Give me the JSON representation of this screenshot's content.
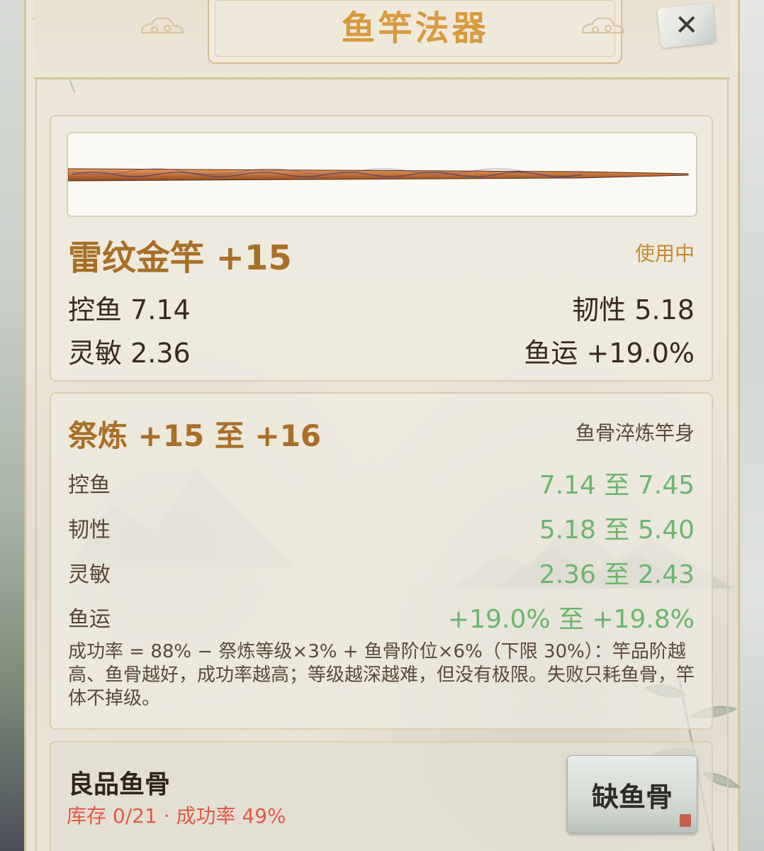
{
  "header": {
    "title": "鱼竿法器",
    "close_label": "✕"
  },
  "rod": {
    "name": "雷纹金竿 +15",
    "status": "使用中",
    "stats": {
      "control": "控鱼 7.14",
      "toughness": "韧性 5.18",
      "agility": "灵敏 2.36",
      "luck": "鱼运 +19.0%"
    }
  },
  "refine": {
    "title": "祭炼 +15 至 +16",
    "method": "鱼骨淬炼竿身",
    "rows": [
      {
        "label": "控鱼",
        "value": "7.14 至 7.45"
      },
      {
        "label": "韧性",
        "value": "5.18 至 5.40"
      },
      {
        "label": "灵敏",
        "value": "2.36 至 2.43"
      },
      {
        "label": "鱼运",
        "value": "+19.0% 至 +19.8%"
      }
    ],
    "formula": "成功率 = 88% − 祭炼等级×3% + 鱼骨阶位×6%（下限 30%）：竿品阶越高、鱼骨越好，成功率越高；等级越深越难，但没有极限。失败只耗鱼骨，竿体不掉级。"
  },
  "material": {
    "name": "良品鱼骨",
    "meta": "库存 0/21 · 成功率 49%",
    "button_label": "缺鱼骨"
  },
  "colors": {
    "title": "#d89a3e",
    "accent": "#a86f26",
    "positive": "#6ab66f",
    "warning": "#e05a45"
  },
  "icons": {
    "close": "close-icon",
    "cloud": "cloud-ornament-icon",
    "rod": "fishing-rod-image"
  }
}
